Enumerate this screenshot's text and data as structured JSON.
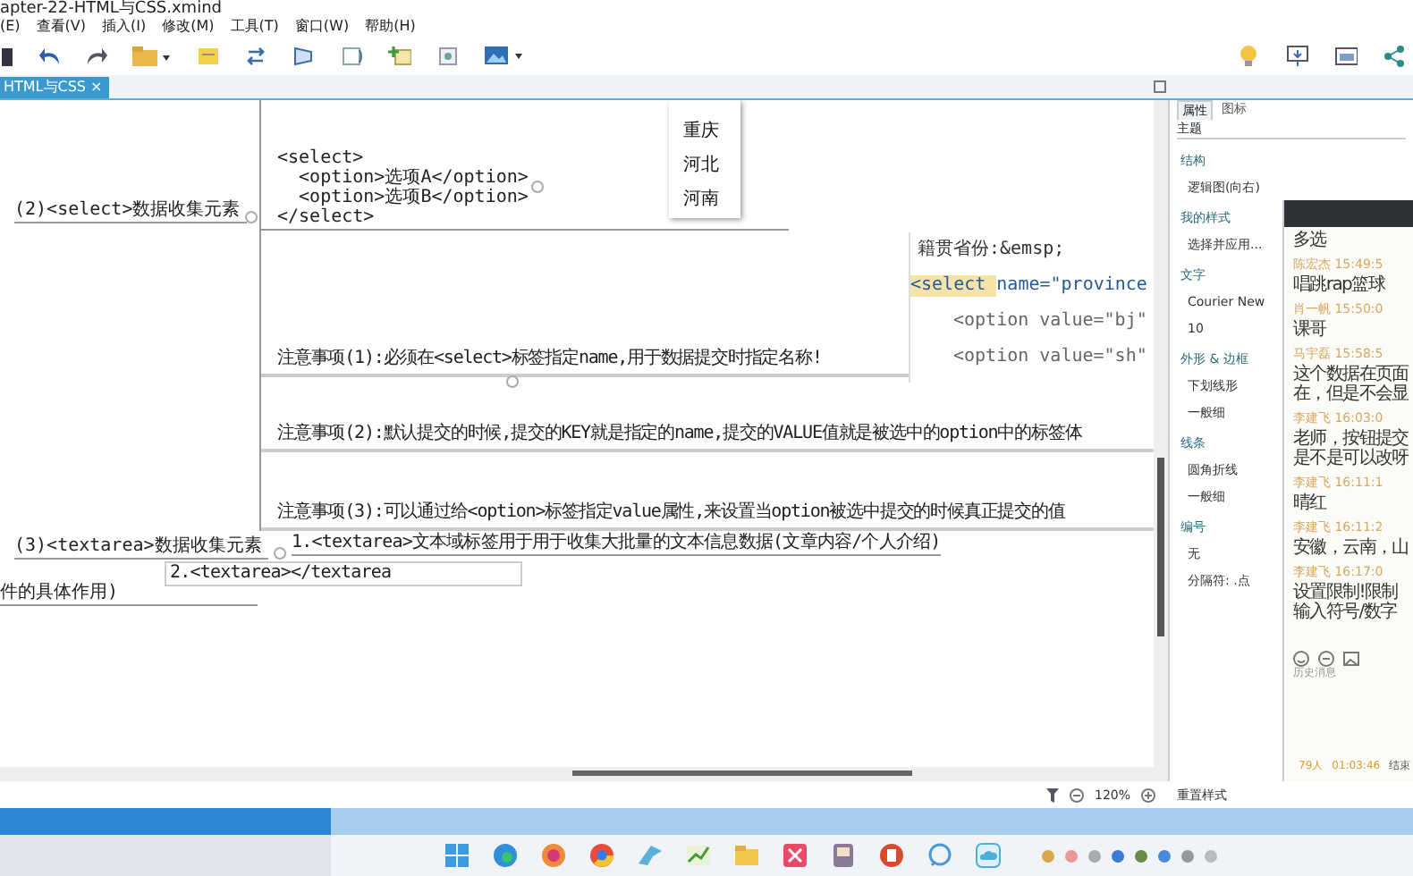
{
  "window": {
    "title": "apter-22-HTML与CSS.xmind"
  },
  "menu": [
    {
      "label": "(E)"
    },
    {
      "label": "查看(V)"
    },
    {
      "label": "插入(I)"
    },
    {
      "label": "修改(M)"
    },
    {
      "label": "工具(T)"
    },
    {
      "label": "窗口(W)"
    },
    {
      "label": "帮助(H)"
    }
  ],
  "tab": {
    "label": "HTML与CSS",
    "close": "×",
    "selected": true
  },
  "map": {
    "select_topic": "(2)<select>数据收集元素",
    "select_code": [
      "<select>",
      "  <option>选项A</option>",
      "  <option>选项B</option>",
      "</select>"
    ],
    "notes": [
      "注意事项(1):必须在<select>标签指定name,用于数据提交时指定名称!",
      "注意事项(2):默认提交的时候,提交的KEY就是指定的name,提交的VALUE值就是被选中的option中的标签体",
      "注意事项(3):可以通过给<option>标签指定value属性,来设置当option被选中提交的时候真正提交的值"
    ],
    "textarea_topic": "(3)<textarea>数据收集元素",
    "textarea_items": [
      {
        "text": "1.<textarea>文本域标签用于用于收集大批量的文本信息数据(文章内容/个人介绍)",
        "editing": false
      },
      {
        "text": "2.<textarea></textarea",
        "editing": true
      }
    ],
    "cut_topic": "件的具体作用)"
  },
  "dropdown": {
    "options": [
      "重庆",
      "河北",
      "河南"
    ]
  },
  "code_overlay": {
    "lines": [
      "籍贯省份:&emsp;",
      "<select name=\"province",
      "<option value=\"bj\"",
      "<option value=\"sh\""
    ]
  },
  "zoom": {
    "value": "120%"
  },
  "properties": {
    "tabs": [
      {
        "label": "属性",
        "selected": true
      },
      {
        "label": "图标",
        "selected": false
      }
    ],
    "header": "主题",
    "sections": [
      {
        "title": "结构",
        "items": [
          "逻辑图(向右)"
        ]
      },
      {
        "title": "我的样式",
        "items": [
          "选择并应用..."
        ]
      },
      {
        "title": "文字",
        "items": [
          "Courier New",
          "10"
        ]
      },
      {
        "title": "外形 & 边框",
        "items": [
          "下划线形",
          "一般细"
        ]
      },
      {
        "title": "线条",
        "items": [
          "圆角折线",
          "一般细"
        ]
      },
      {
        "title": "编号",
        "items": [
          "无",
          "分隔符: .点"
        ]
      }
    ],
    "reset": "重置样式"
  },
  "chat": {
    "messages": [
      {
        "lines": [
          "多选"
        ]
      },
      {
        "name": "陈宏杰",
        "time": "15:49:5",
        "lines": [
          "唱跳rap篮球"
        ]
      },
      {
        "name": "肖一帆",
        "time": "15:50:0",
        "lines": [
          "课哥"
        ]
      },
      {
        "name": "马宇磊",
        "time": "15:58:5",
        "lines": [
          "这个数据在页面",
          "在，但是不会显"
        ]
      },
      {
        "name": "李建飞",
        "time": "16:03:0",
        "lines": [
          "老师，按钮提交",
          "是不是可以改呀"
        ]
      },
      {
        "name": "李建飞",
        "time": "16:11:1",
        "lines": [
          "晴红"
        ]
      },
      {
        "name": "李建飞",
        "time": "16:11:2",
        "lines": [
          "安徽，云南，山"
        ]
      },
      {
        "name": "李建飞",
        "time": "16:17:0",
        "lines": [
          "设置限制!限制",
          "输入符号/数字"
        ]
      }
    ],
    "history": "历史消息",
    "footer": {
      "count": "79人",
      "duration": "01:03:46",
      "action": "结束"
    }
  }
}
